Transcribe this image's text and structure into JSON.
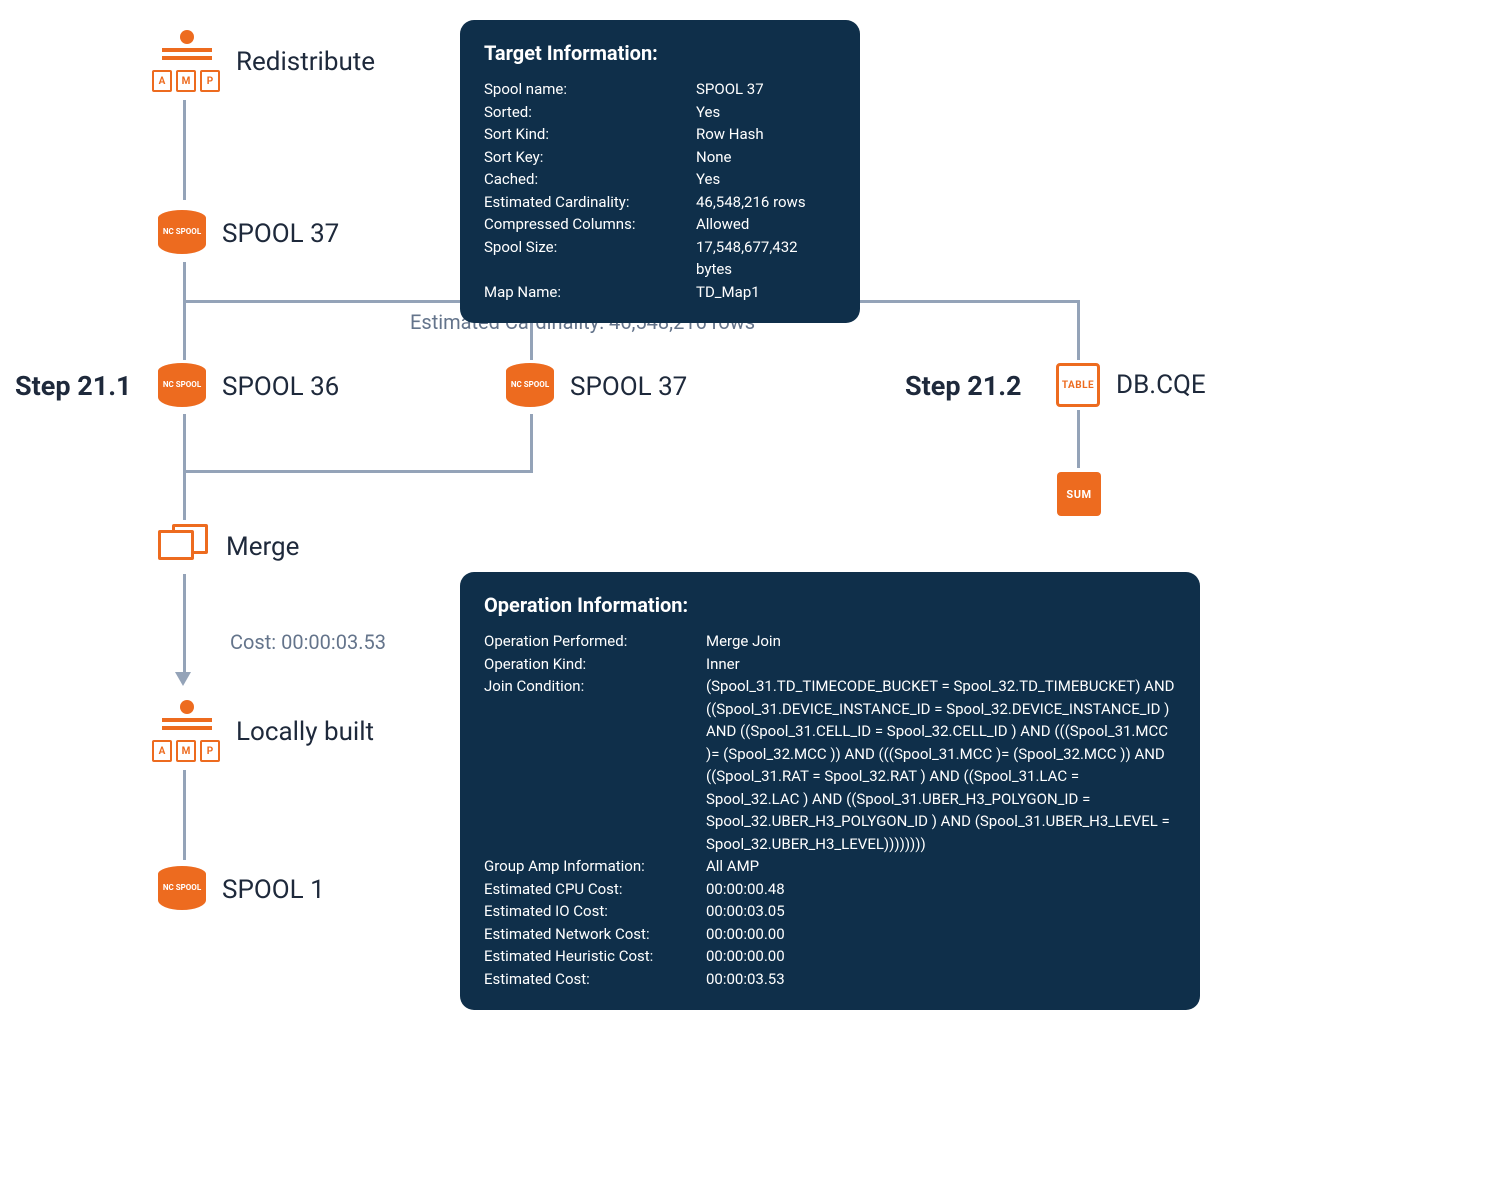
{
  "nodes": {
    "redistribute_label": "Redistribute",
    "spool37_top_label": "SPOOL 37",
    "spool36_label": "SPOOL 36",
    "spool37_mid_label": "SPOOL 37",
    "dbcqe_label": "DB.CQE",
    "merge_label": "Merge",
    "locally_built_label": "Locally built",
    "spool1_label": "SPOOL 1",
    "step21_1": "Step 21.1",
    "step21_2": "Step 21.2",
    "cost_label": "Cost: 00:00:03.53",
    "est_card_label": "Estimated Cardinality: 46,548,216 rows",
    "topo_box_a": "A",
    "topo_box_m": "M",
    "topo_box_p": "P",
    "spool_icon_txt": "NC\nSPOOL",
    "table_icon_txt": "TABLE",
    "sum_icon_txt": "SUM"
  },
  "target_panel": {
    "title": "Target Information:",
    "rows": [
      {
        "k": "Spool name:",
        "v": "SPOOL 37"
      },
      {
        "k": "Sorted:",
        "v": "Yes"
      },
      {
        "k": "Sort Kind:",
        "v": "Row Hash"
      },
      {
        "k": "Sort Key:",
        "v": "None"
      },
      {
        "k": "Cached:",
        "v": "Yes"
      },
      {
        "k": "Estimated Cardinality:",
        "v": "46,548,216 rows"
      },
      {
        "k": "Compressed Columns:",
        "v": "Allowed"
      },
      {
        "k": "Spool Size:",
        "v": "17,548,677,432 bytes"
      },
      {
        "k": "Map Name:",
        "v": "TD_Map1"
      }
    ]
  },
  "op_panel": {
    "title": "Operation Information:",
    "rows": [
      {
        "k": "Operation Performed:",
        "v": "Merge Join"
      },
      {
        "k": "Operation Kind:",
        "v": "Inner"
      },
      {
        "k": "Join Condition:",
        "v": "(Spool_31.TD_TIMECODE_BUCKET = Spool_32.TD_TIMEBUCKET) AND ((Spool_31.DEVICE_INSTANCE_ID = Spool_32.DEVICE_INSTANCE_ID ) AND ((Spool_31.CELL_ID = Spool_32.CELL_ID ) AND (((Spool_31.MCC )= (Spool_32.MCC )) AND (((Spool_31.MCC )= (Spool_32.MCC )) AND ((Spool_31.RAT = Spool_32.RAT ) AND ((Spool_31.LAC = Spool_32.LAC ) AND ((Spool_31.UBER_H3_POLYGON_ID = Spool_32.UBER_H3_POLYGON_ID ) AND (Spool_31.UBER_H3_LEVEL = Spool_32.UBER_H3_LEVEL))))))))"
      },
      {
        "k": "Group Amp Information:",
        "v": "All AMP"
      },
      {
        "k": "Estimated CPU Cost:",
        "v": "00:00:00.48"
      },
      {
        "k": "Estimated IO Cost:",
        "v": "00:00:03.05"
      },
      {
        "k": "Estimated Network Cost:",
        "v": "00:00:00.00"
      },
      {
        "k": "Estimated Heuristic Cost:",
        "v": "00:00:00.00"
      },
      {
        "k": "Estimated Cost:",
        "v": "00:00:03.53"
      }
    ]
  }
}
